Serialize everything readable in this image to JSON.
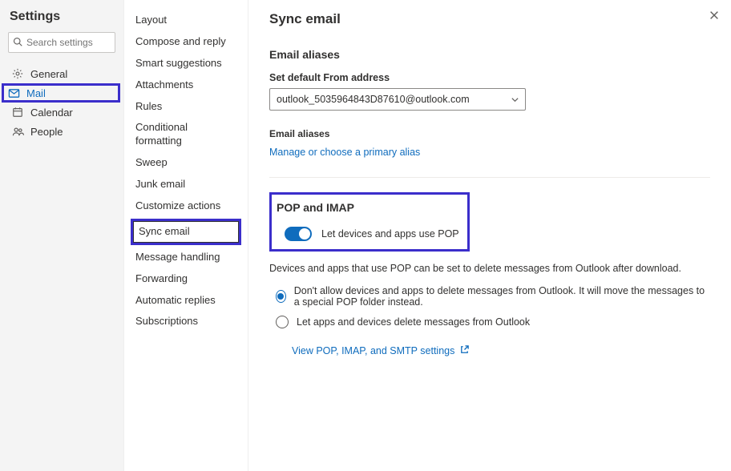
{
  "settings_title": "Settings",
  "search": {
    "placeholder": "Search settings"
  },
  "nav1": {
    "general": "General",
    "mail": "Mail",
    "calendar": "Calendar",
    "people": "People"
  },
  "nav2": {
    "items": [
      "Layout",
      "Compose and reply",
      "Smart suggestions",
      "Attachments",
      "Rules",
      "Conditional formatting",
      "Sweep",
      "Junk email",
      "Customize actions",
      "Sync email",
      "Message handling",
      "Forwarding",
      "Automatic replies",
      "Subscriptions"
    ]
  },
  "main": {
    "page_title": "Sync email",
    "aliases_title": "Email aliases",
    "from_label": "Set default From address",
    "from_value": "outlook_5035964843D87610@outlook.com",
    "aliases_sub": "Email aliases",
    "manage_link": "Manage or choose a primary alias",
    "pop_title": "POP and IMAP",
    "toggle_label": "Let devices and apps use POP",
    "pop_desc": "Devices and apps that use POP can be set to delete messages from Outlook after download.",
    "radio1": "Don't allow devices and apps to delete messages from Outlook. It will move the messages to a special POP folder instead.",
    "radio2": "Let apps and devices delete messages from Outlook",
    "view_link": "View POP, IMAP, and SMTP settings"
  }
}
